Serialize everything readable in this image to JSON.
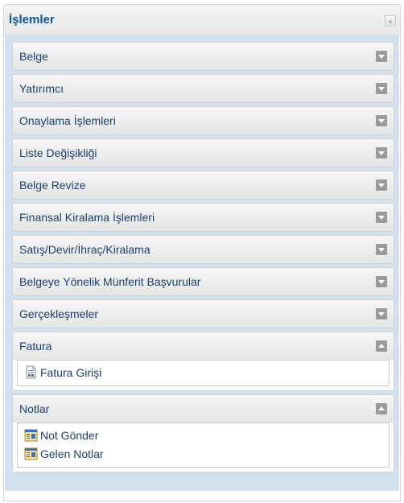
{
  "panel": {
    "title": "İşlemler",
    "collapse_glyph": "«"
  },
  "accordion": {
    "items": [
      {
        "label": "Belge",
        "expanded": false
      },
      {
        "label": "Yatırımcı",
        "expanded": false
      },
      {
        "label": "Onaylama İşlemleri",
        "expanded": false
      },
      {
        "label": "Liste Değişikliği",
        "expanded": false
      },
      {
        "label": "Belge Revize",
        "expanded": false
      },
      {
        "label": "Finansal Kiralama İşlemleri",
        "expanded": false
      },
      {
        "label": "Satış/Devir/İhraç/Kiralama",
        "expanded": false
      },
      {
        "label": "Belgeye Yönelik Münferit Başvurular",
        "expanded": false
      },
      {
        "label": "Gerçekleşmeler",
        "expanded": false
      },
      {
        "label": "Fatura",
        "expanded": true,
        "links": [
          {
            "label": "Fatura Girişi",
            "icon": "form-document-icon"
          }
        ]
      },
      {
        "label": "Notlar",
        "expanded": true,
        "links": [
          {
            "label": "Not Gönder",
            "icon": "note-icon"
          },
          {
            "label": "Gelen Notlar",
            "icon": "note-icon"
          }
        ]
      }
    ]
  },
  "colors": {
    "title": "#0e5795",
    "item_text": "#1c3f6e",
    "body_background": "#d3e0f0",
    "toggle_button": "#9a9a9a"
  }
}
